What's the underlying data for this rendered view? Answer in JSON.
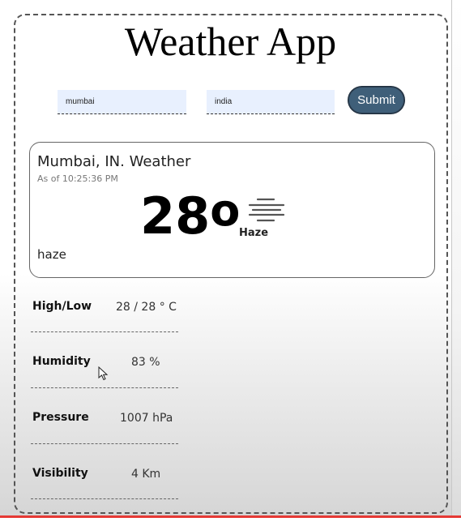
{
  "app": {
    "title": "Weather App"
  },
  "form": {
    "city_value": "mumbai",
    "country_value": "india",
    "submit_label": "Submit"
  },
  "weather": {
    "location": "Mumbai, IN. Weather",
    "as_of": "As of 10:25:36 PM",
    "temperature": "28",
    "degree_symbol": "o",
    "icon": "haze-icon",
    "icon_label": "Haze",
    "description": "haze"
  },
  "details": [
    {
      "label": "High/Low",
      "value": "28 / 28 ° C"
    },
    {
      "label": "Humidity",
      "value": "83 %"
    },
    {
      "label": "Pressure",
      "value": "1007 hPa"
    },
    {
      "label": "Visibility",
      "value": "4 Km"
    }
  ],
  "colors": {
    "submit_bg": "#3f5f79",
    "input_bg": "#e8f0fe",
    "accent_line": "#e53935"
  }
}
